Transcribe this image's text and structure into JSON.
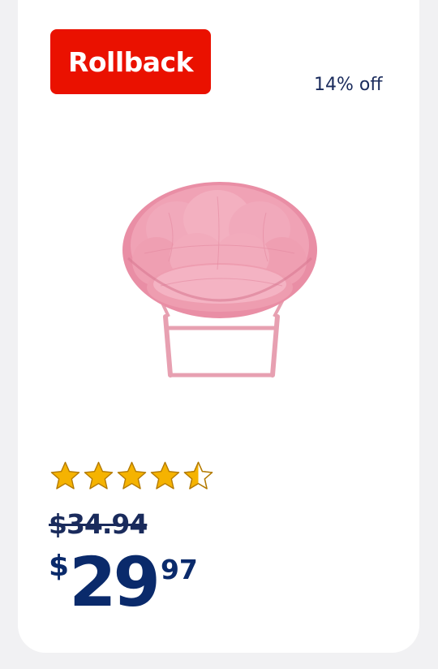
{
  "badge": {
    "label": "Rollback"
  },
  "discount": {
    "label": "14% off"
  },
  "product": {
    "image_icon": "pink-saucer-chair-image",
    "rating": 4.5,
    "star_color": "#f5b301",
    "star_outline": "#b37a00"
  },
  "pricing": {
    "was": "$34.94",
    "currency": "$",
    "dollars": "29",
    "cents": "97"
  },
  "colors": {
    "badge_bg": "#ea1100",
    "price_text": "#0a2a6b",
    "background": "#f1f1f3"
  }
}
